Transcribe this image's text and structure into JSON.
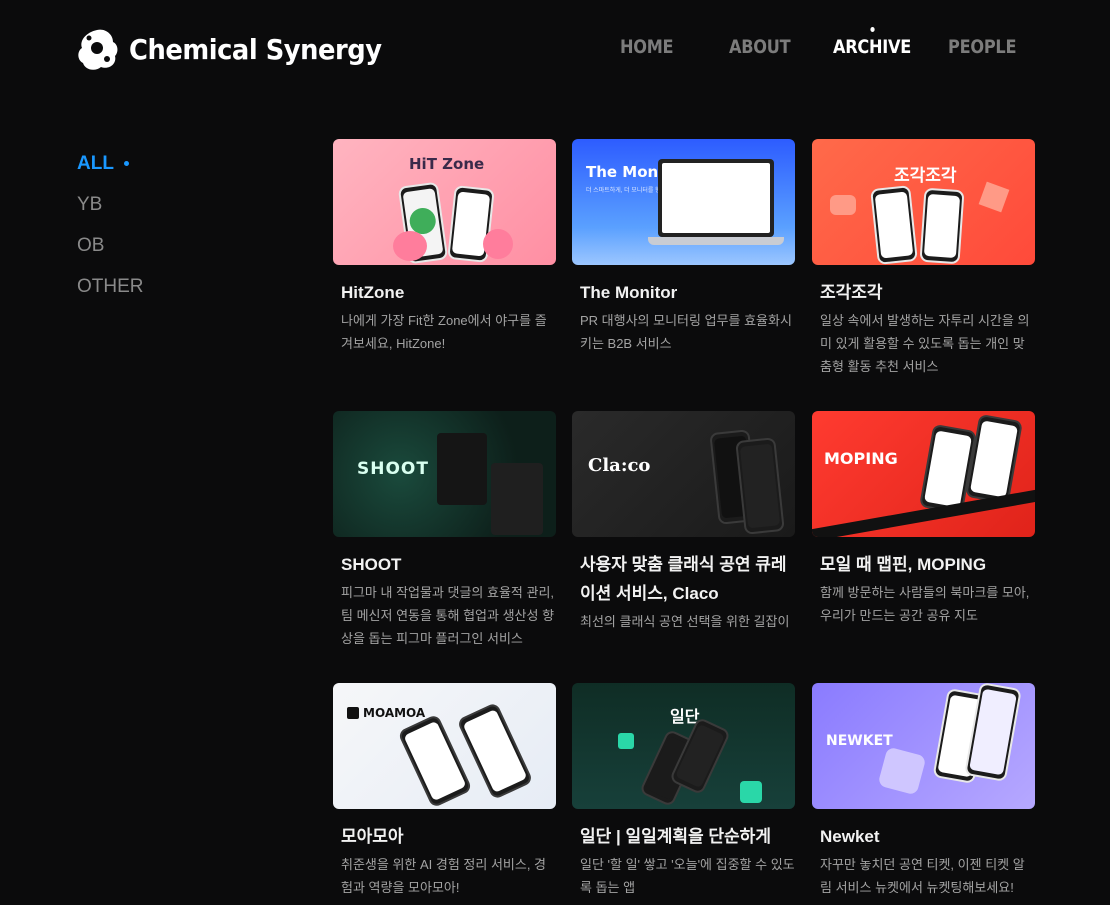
{
  "brand": {
    "name": "Chemical Synergy",
    "logo_icon": "chemical-blob-icon"
  },
  "nav": [
    {
      "label": "HOME",
      "active": false
    },
    {
      "label": "ABOUT",
      "active": false
    },
    {
      "label": "ARCHIVE",
      "active": true
    },
    {
      "label": "PEOPLE",
      "active": false
    }
  ],
  "filters": [
    {
      "label": "ALL",
      "active": true
    },
    {
      "label": "YB",
      "active": false
    },
    {
      "label": "OB",
      "active": false
    },
    {
      "label": "OTHER",
      "active": false
    }
  ],
  "colors": {
    "accent": "#1a98ff",
    "background": "#0b0b0c",
    "nav_inactive": "#7c7c7c"
  },
  "projects": [
    {
      "title": "HitZone",
      "desc": "나에게 가장 Fit한 Zone에서 야구를 즐겨보세요, HitZone!",
      "thumb_text": "HiT Zone"
    },
    {
      "title": "The Monitor",
      "desc": "PR 대행사의 모니터링 업무를 효율화시키는 B2B 서비스",
      "thumb_text": "The Monitor",
      "thumb_sub": "더 스마트하게, 더 모니터를 향해."
    },
    {
      "title": "조각조각",
      "desc": "일상 속에서 발생하는 자투리 시간을 의미 있게 활용할 수 있도록 돕는 개인 맞춤형 활동 추천 서비스",
      "thumb_text": "조각조각"
    },
    {
      "title": "SHOOT",
      "desc": "피그마 내 작업물과 댓글의 효율적 관리, 팀 메신저 연동을 통해 협업과 생산성 향상을 돕는 피그마 플러그인 서비스",
      "thumb_text": "SHOOT"
    },
    {
      "title": "사용자 맞춤 클래식 공연 큐레이션 서비스, Claco",
      "desc": "최선의 클래식 공연 선택을 위한 길잡이",
      "thumb_text": "Cla:co"
    },
    {
      "title": "모일 때 맵핀, MOPING",
      "desc": "함께 방문하는 사람들의 북마크를 모아, 우리가 만드는 공간 공유 지도",
      "thumb_text": "MOPING"
    },
    {
      "title": "모아모아",
      "desc": "취준생을 위한 AI 경험 정리 서비스, 경험과 역량을 모아모아!",
      "thumb_text": "MOAMOA"
    },
    {
      "title": "일단 | 일일계획을 단순하게",
      "desc": "일단 '할 일' 쌓고 '오늘'에 집중할 수 있도록 돕는 앱",
      "thumb_text": "일단"
    },
    {
      "title": "Newket",
      "desc": "자꾸만 놓치던 공연 티켓, 이젠 티켓 알림 서비스 뉴켓에서 뉴켓팅해보세요!",
      "thumb_text": "NEWKET"
    }
  ]
}
